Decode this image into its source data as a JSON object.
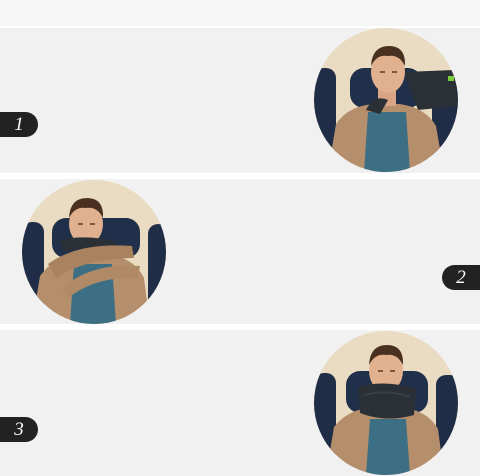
{
  "steps": [
    {
      "number": "1"
    },
    {
      "number": "2"
    },
    {
      "number": "3"
    }
  ],
  "colors": {
    "background": "#ffffff",
    "panel": "#f1f1f1",
    "badge": "#222222",
    "badge_text": "#ffffff",
    "jacket": "#b58e6c",
    "shirt": "#3c6e84",
    "pillow": "#2b2f36",
    "seat": "#1f2d46"
  },
  "icons": [
    "step-photo-illustration"
  ]
}
